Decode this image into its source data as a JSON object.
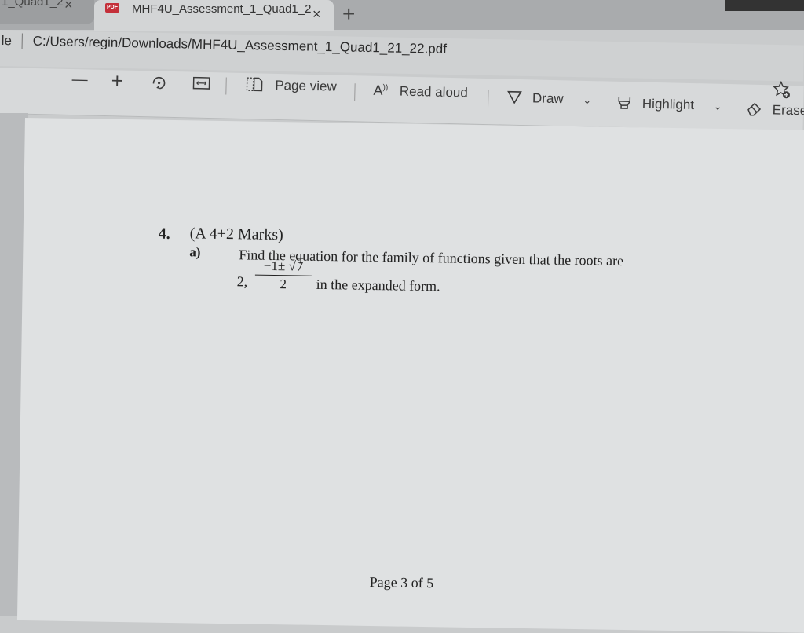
{
  "tabs": [
    {
      "label": "1_Quad1_2",
      "active": false
    },
    {
      "label": "MHF4U_Assessment_1_Quad1_2",
      "active": true,
      "icon": "pdf-icon",
      "icon_text": "PDF"
    }
  ],
  "tab_close_glyph": "×",
  "new_tab_glyph": "+",
  "address": {
    "prefix": "le",
    "url": "C:/Users/regin/Downloads/MHF4U_Assessment_1_Quad1_21_22.pdf"
  },
  "toolbar": {
    "zoom_out": "—",
    "zoom_in": "+",
    "page_view": "Page view",
    "read_aloud": "Read aloud",
    "draw": "Draw",
    "highlight": "Highlight",
    "erase": "Erase",
    "dropdown_glyph": "⌄"
  },
  "document": {
    "question_number": "4.",
    "marks": "(A 4+2 Marks)",
    "part_label": "a)",
    "question_text": "Find the equation for the family of functions given that the roots are",
    "root_first": "2,",
    "fraction_numerator_prefix": "−1± ",
    "fraction_numerator_radicand": "7",
    "fraction_denominator": "2",
    "question_tail": "in the expanded form.",
    "footer": "Page 3 of 5"
  }
}
